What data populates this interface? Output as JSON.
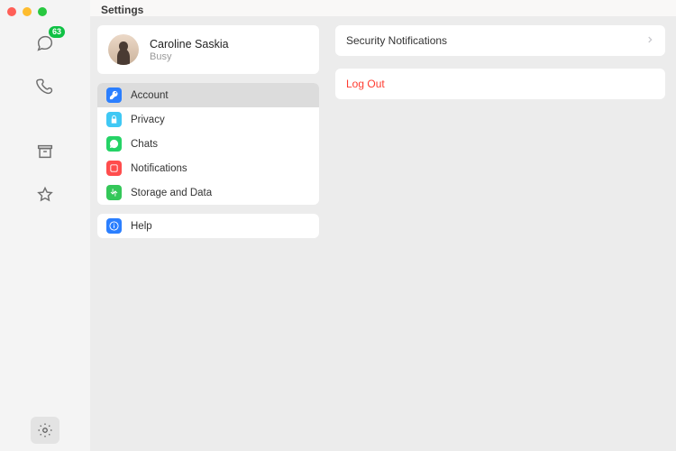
{
  "window": {
    "title": "Settings"
  },
  "rail": {
    "chats_badge": "63"
  },
  "profile": {
    "name": "Caroline Saskia",
    "status": "Busy"
  },
  "menu": {
    "account": "Account",
    "privacy": "Privacy",
    "chats": "Chats",
    "notifications": "Notifications",
    "storage": "Storage and Data",
    "help": "Help"
  },
  "detail": {
    "security_notifications": "Security Notifications",
    "logout": "Log Out"
  }
}
